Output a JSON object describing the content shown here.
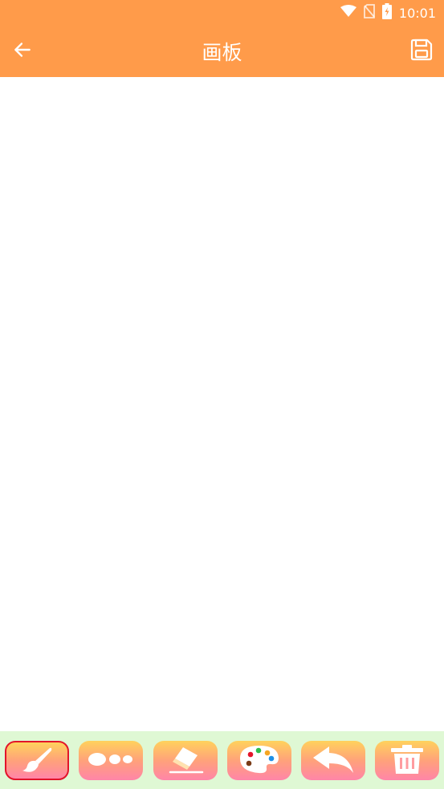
{
  "status_bar": {
    "time": "10:01",
    "icons": [
      "wifi-icon",
      "no-sim-icon",
      "battery-charging-icon"
    ]
  },
  "app_bar": {
    "title": "画板",
    "back_icon": "arrow-left-icon",
    "save_icon": "save-icon",
    "background": "#FF9B4A"
  },
  "canvas": {
    "background": "#ffffff"
  },
  "toolbar": {
    "background": "#DFF8D4",
    "selected_border": "#E3142A",
    "tools": [
      {
        "name": "brush",
        "icon": "paintbrush-icon",
        "selected": true
      },
      {
        "name": "stroke-size",
        "icon": "dots-icon",
        "selected": false
      },
      {
        "name": "eraser",
        "icon": "eraser-icon",
        "selected": false
      },
      {
        "name": "color",
        "icon": "palette-icon",
        "selected": false
      },
      {
        "name": "undo",
        "icon": "undo-icon",
        "selected": false
      },
      {
        "name": "clear",
        "icon": "trash-icon",
        "selected": false
      }
    ]
  }
}
